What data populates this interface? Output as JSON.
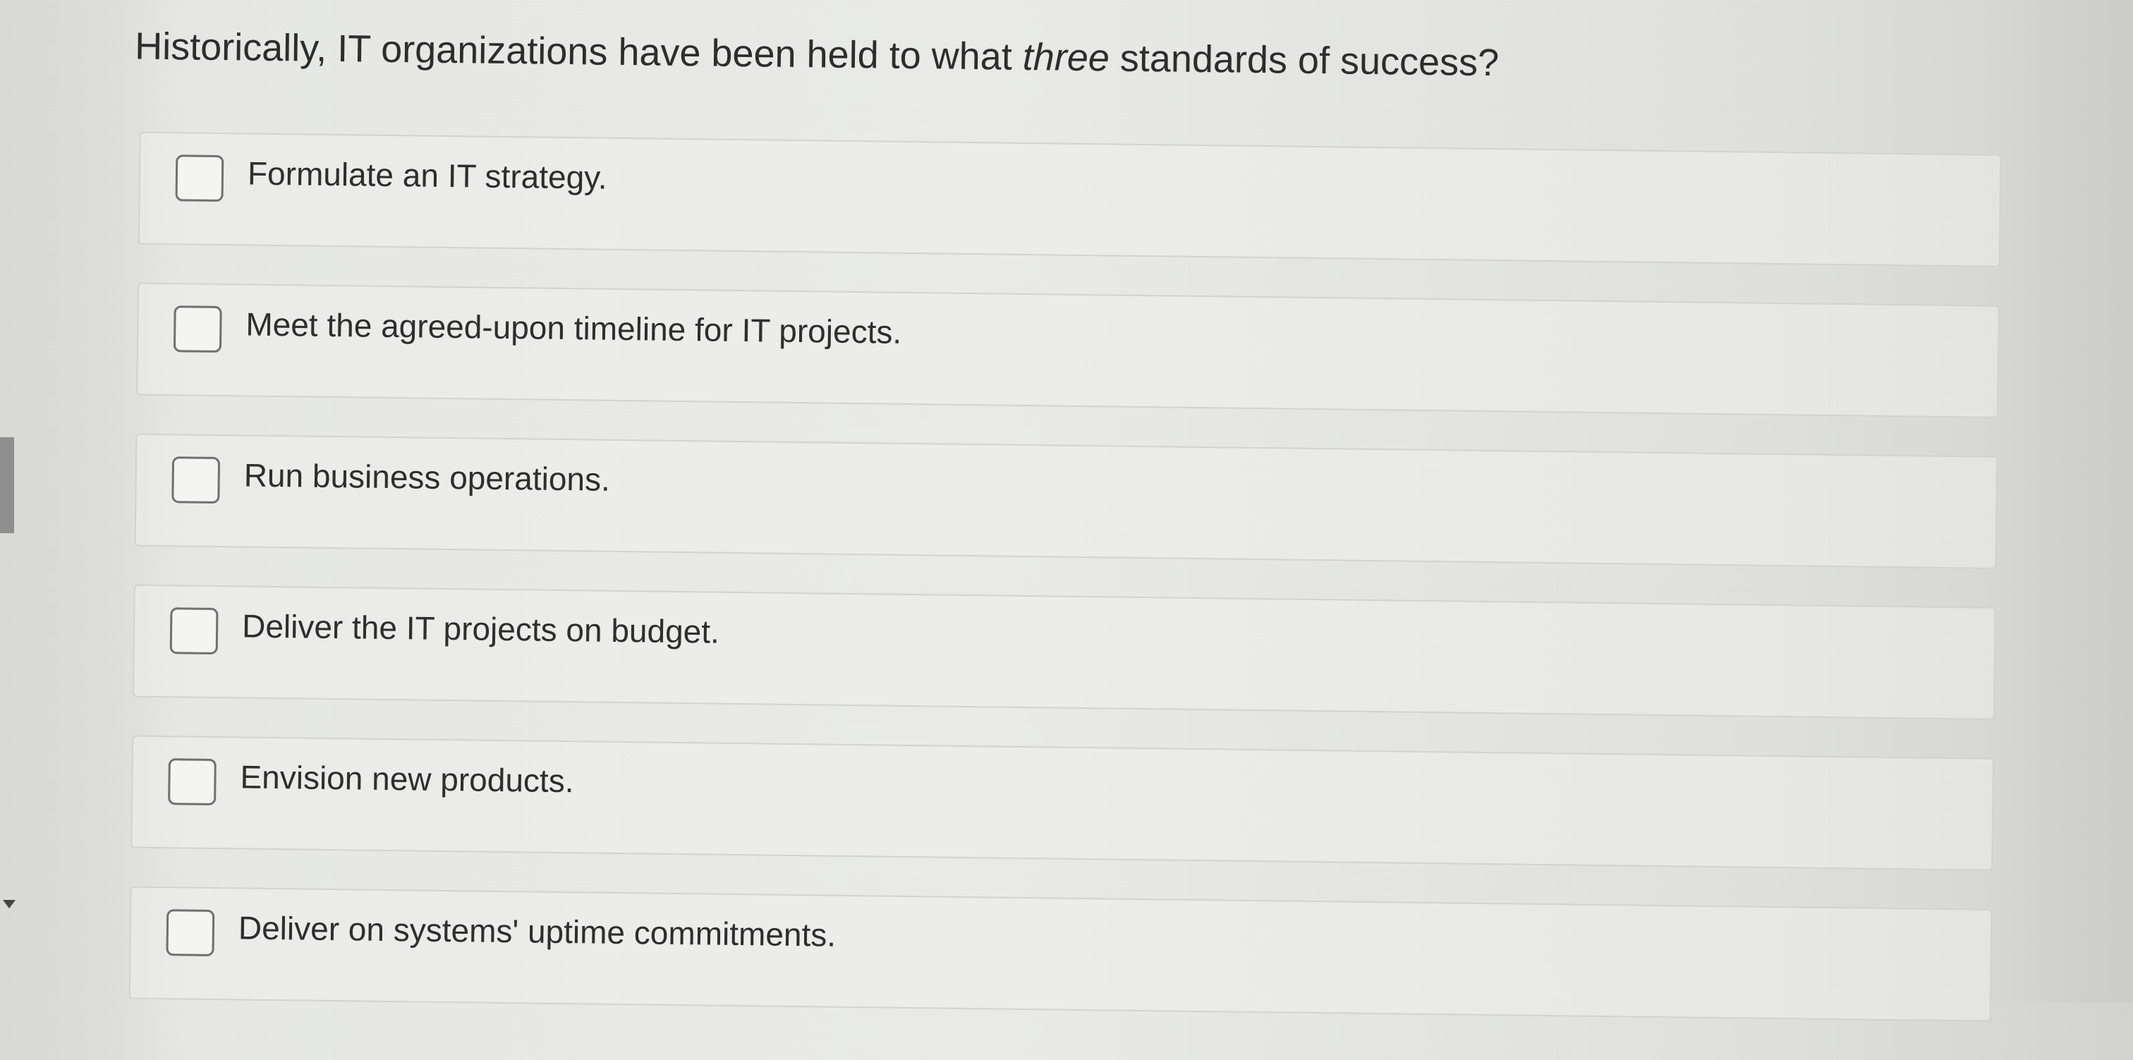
{
  "question": {
    "before": "Historically, IT organizations have been held to what ",
    "emphasis": "three",
    "after": " standards of success?"
  },
  "options": [
    {
      "label": "Formulate an IT strategy.",
      "checked": false
    },
    {
      "label": "Meet the agreed-upon timeline for IT projects.",
      "checked": false
    },
    {
      "label": "Run business operations.",
      "checked": false
    },
    {
      "label": "Deliver the IT projects on budget.",
      "checked": false
    },
    {
      "label": "Envision new products.",
      "checked": false
    },
    {
      "label": "Deliver on systems' uptime commitments.",
      "checked": false
    }
  ],
  "icons": {
    "checkbox": "empty-checkbox-icon",
    "left_edge_arrow": "caret-down-icon"
  }
}
